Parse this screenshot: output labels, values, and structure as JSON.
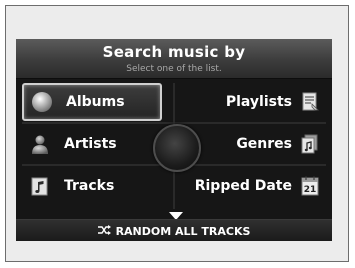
{
  "header": {
    "title": "Search music by",
    "subtitle": "Select one of the list."
  },
  "menu": {
    "albums": {
      "label": "Albums",
      "icon": "disc-icon"
    },
    "artists": {
      "label": "Artists",
      "icon": "person-icon"
    },
    "tracks": {
      "label": "Tracks",
      "icon": "music-note-icon"
    },
    "playlists": {
      "label": "Playlists",
      "icon": "playlist-icon"
    },
    "genres": {
      "label": "Genres",
      "icon": "genre-icon"
    },
    "ripped_date": {
      "label": "Ripped Date",
      "icon": "calendar-icon",
      "icon_text": "21"
    }
  },
  "bottom": {
    "shuffle_icon": "shuffle-icon",
    "label": "RANDOM ALL TRACKS"
  },
  "colors": {
    "screen_bg": "#161616",
    "text": "#ffffff",
    "selection_border": "#cfcfcf"
  }
}
